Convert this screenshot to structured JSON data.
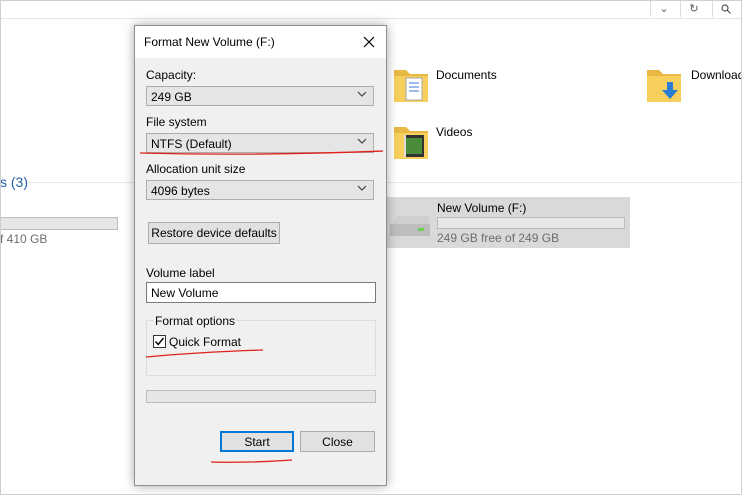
{
  "explorer": {
    "section_header": "s (3)",
    "left_drive_free": "f 410 GB",
    "folders": [
      {
        "name": "Documents",
        "icon": "documents-folder-icon"
      },
      {
        "name": "Downloads",
        "icon": "downloads-folder-icon"
      },
      {
        "name": "Videos",
        "icon": "videos-folder-icon"
      }
    ],
    "drive": {
      "name": "New Volume (F:)",
      "free_text": "249 GB free of 249 GB",
      "used_fraction": 0.0,
      "icon": "drive-icon"
    },
    "topbar_icons": [
      "chevron-down-icon",
      "refresh-icon",
      "search-icon"
    ]
  },
  "dialog": {
    "title": "Format New Volume (F:)",
    "close_icon": "close-icon",
    "capacity_label": "Capacity:",
    "capacity_value": "249 GB",
    "filesystem_label": "File system",
    "filesystem_value": "NTFS (Default)",
    "allocation_label": "Allocation unit size",
    "allocation_value": "4096 bytes",
    "restore_button": "Restore device defaults",
    "volume_label_label": "Volume label",
    "volume_label_value": "New Volume",
    "format_options_label": "Format options",
    "quick_format_label": "Quick Format",
    "quick_format_checked": true,
    "progress": 0,
    "start_button": "Start",
    "close_button": "Close"
  },
  "colors": {
    "accent": "#0078d7",
    "annotation": "#e0201a",
    "section_header": "#1f5ea8"
  }
}
